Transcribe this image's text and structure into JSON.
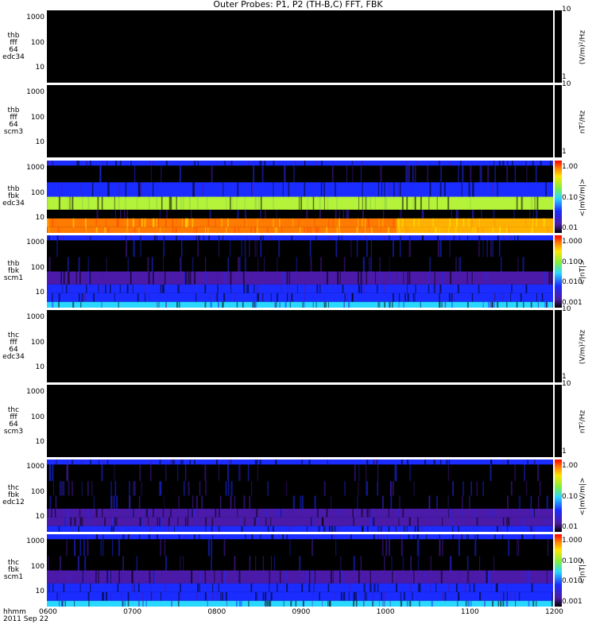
{
  "title": "Outer Probes: P1, P2 (TH-B,C) FFT, FBK",
  "colors": {
    "background": "#000000",
    "separator": "#ffffff",
    "blue": "#1a2cff",
    "purple": "#4b1aa8",
    "green": "#b5f23a",
    "orange": "#ff7a00",
    "yellow": "#ffe600",
    "cyan": "#29d8ff"
  },
  "x_axis": {
    "header": [
      "hhmm",
      "2011 Sep 22"
    ],
    "ticks": [
      "0600",
      "0700",
      "0800",
      "0900",
      "1000",
      "1100",
      "1200"
    ]
  },
  "chart_data": [
    {
      "type": "heatmap",
      "name_lines": [
        "thb",
        "fff",
        "64",
        "edc34"
      ],
      "yscale": "log",
      "yticks": [
        "1000",
        "100",
        "10"
      ],
      "cbar_ticks": [
        "10",
        "1"
      ],
      "cbar_unit": "(V/m)²/Hz",
      "cbar_type": "gray",
      "xlim": [
        "0600",
        "1200"
      ],
      "content": "empty"
    },
    {
      "type": "heatmap",
      "name_lines": [
        "thb",
        "fff",
        "64",
        "scm3"
      ],
      "yscale": "log",
      "yticks": [
        "1000",
        "100",
        "10"
      ],
      "cbar_ticks": [
        "10",
        "1"
      ],
      "cbar_unit": "nT²/Hz",
      "cbar_type": "gray",
      "xlim": [
        "0600",
        "1200"
      ],
      "content": "empty"
    },
    {
      "type": "heatmap",
      "name_lines": [
        "thb",
        "fbk",
        "edc34"
      ],
      "yscale": "log",
      "yticks": [
        "1000",
        "100",
        "10"
      ],
      "cbar_ticks": [
        "1.00",
        "0.10",
        "0.01"
      ],
      "cbar_unit": "<|mV/m|>",
      "cbar_type": "rainbow",
      "xlim": [
        "0600",
        "1200"
      ],
      "bands_top_to_bottom": [
        "blue",
        "black",
        "blue",
        "green",
        "black",
        "orange",
        "orange"
      ]
    },
    {
      "type": "heatmap",
      "name_lines": [
        "thb",
        "fbk",
        "scm1"
      ],
      "yscale": "log",
      "yticks": [
        "1000",
        "100",
        "10"
      ],
      "cbar_ticks": [
        "1.000",
        "0.100",
        "0.010",
        "0.001"
      ],
      "cbar_unit": "<|nT|>",
      "cbar_type": "rainbow",
      "xlim": [
        "0600",
        "1200"
      ],
      "bands_top_to_bottom": [
        "blue",
        "black",
        "black",
        "purple",
        "blue",
        "blue",
        "cyan"
      ]
    },
    {
      "type": "heatmap",
      "name_lines": [
        "thc",
        "fff",
        "64",
        "edc34"
      ],
      "yscale": "log",
      "yticks": [
        "1000",
        "100",
        "10"
      ],
      "cbar_ticks": [
        "10",
        "1"
      ],
      "cbar_unit": "(V/m)²/Hz",
      "cbar_type": "gray",
      "xlim": [
        "0600",
        "1200"
      ],
      "content": "empty"
    },
    {
      "type": "heatmap",
      "name_lines": [
        "thc",
        "fff",
        "64",
        "scm3"
      ],
      "yscale": "log",
      "yticks": [
        "1000",
        "100",
        "10"
      ],
      "cbar_ticks": [
        "10",
        "1"
      ],
      "cbar_unit": "nT²/Hz",
      "cbar_type": "gray",
      "xlim": [
        "0600",
        "1200"
      ],
      "content": "empty"
    },
    {
      "type": "heatmap",
      "name_lines": [
        "thc",
        "fbk",
        "edc12"
      ],
      "yscale": "log",
      "yticks": [
        "1000",
        "100",
        "10"
      ],
      "cbar_ticks": [
        "1.00",
        "0.10",
        "0.01"
      ],
      "cbar_unit": "<|mV/m|>",
      "cbar_type": "rainbow",
      "xlim": [
        "0600",
        "1200"
      ],
      "bands_top_to_bottom": [
        "blue",
        "black",
        "black",
        "black",
        "purple",
        "purple",
        "blue"
      ]
    },
    {
      "type": "heatmap",
      "name_lines": [
        "thc",
        "fbk",
        "scm1"
      ],
      "yscale": "log",
      "yticks": [
        "1000",
        "100",
        "10"
      ],
      "cbar_ticks": [
        "1.000",
        "0.100",
        "0.010",
        "0.001"
      ],
      "cbar_unit": "<|nT|>",
      "cbar_type": "rainbow",
      "xlim": [
        "0600",
        "1200"
      ],
      "bands_top_to_bottom": [
        "blue",
        "black",
        "black",
        "purple",
        "blue",
        "blue",
        "cyan"
      ]
    }
  ]
}
